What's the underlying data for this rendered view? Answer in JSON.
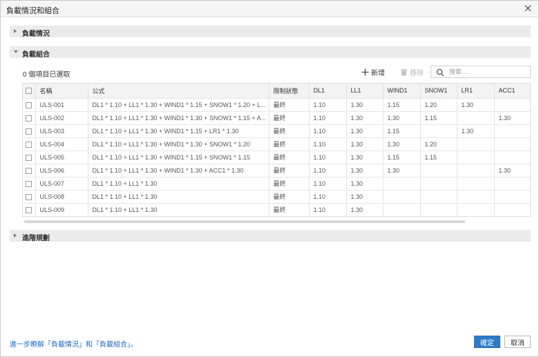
{
  "dialog": {
    "title": "負載情況和組合"
  },
  "sections": {
    "load_cases": "負載情況",
    "load_combinations": "負載組合",
    "advanced": "進階規劃"
  },
  "toolbar": {
    "selected_count": "0 個項目已選取",
    "add_label": "新增",
    "remove_label": "移除",
    "search_placeholder": "搜索..."
  },
  "table": {
    "columns": [
      "",
      "名稱",
      "公式",
      "限制狀態",
      "DL1",
      "LL1",
      "WIND1",
      "SNOW1",
      "LR1",
      "ACC1"
    ],
    "rows": [
      [
        "",
        "ULS-001",
        "DL1 * 1.10 + LL1 * 1.30 + WIND1 * 1.15 + SNOW1 * 1.20 + L...",
        "最終",
        "1.10",
        "1.30",
        "1.15",
        "1.20",
        "1.30",
        ""
      ],
      [
        "",
        "ULS-002",
        "DL1 * 1.10 + LL1 * 1.30 + WIND1 * 1.30 + SNOW1 * 1.15 + A...",
        "最終",
        "1.10",
        "1.30",
        "1.30",
        "1.15",
        "",
        "1.30"
      ],
      [
        "",
        "ULS-003",
        "DL1 * 1.10 + LL1 * 1.30 + WIND1 * 1.15 + LR1 * 1.30",
        "最終",
        "1.10",
        "1.30",
        "1.15",
        "",
        "1.30",
        ""
      ],
      [
        "",
        "ULS-004",
        "DL1 * 1.10 + LL1 * 1.30 + WIND1 * 1.30 + SNOW1 * 1.20",
        "最終",
        "1.10",
        "1.30",
        "1.30",
        "1.20",
        "",
        ""
      ],
      [
        "",
        "ULS-005",
        "DL1 * 1.10 + LL1 * 1.30 + WIND1 * 1.15 + SNOW1 * 1.15",
        "最終",
        "1.10",
        "1.30",
        "1.15",
        "1.15",
        "",
        ""
      ],
      [
        "",
        "ULS-006",
        "DL1 * 1.10 + LL1 * 1.30 + WIND1 * 1.30 + ACC1 * 1.30",
        "最終",
        "1.10",
        "1.30",
        "1.30",
        "",
        "",
        "1.30"
      ],
      [
        "",
        "ULS-007",
        "DL1 * 1.10 + LL1 * 1.30",
        "最終",
        "1.10",
        "1.30",
        "",
        "",
        "",
        ""
      ],
      [
        "",
        "ULS-008",
        "DL1 * 1.10 + LL1 * 1.30",
        "最終",
        "1.10",
        "1.30",
        "",
        "",
        "",
        ""
      ],
      [
        "",
        "ULS-009",
        "DL1 * 1.10 + LL1 * 1.30",
        "最終",
        "1.10",
        "1.30",
        "",
        "",
        "",
        ""
      ]
    ]
  },
  "footer": {
    "help_link": "進一步瞭解「負載情況」和「負載組合」。",
    "ok_label": "確定",
    "cancel_label": "取消"
  },
  "icons": {
    "close": "close-icon",
    "collapsed": "caret-right-icon",
    "expanded": "caret-down-icon",
    "add": "plus-icon",
    "remove": "trash-icon",
    "search": "search-icon"
  },
  "colors": {
    "accent": "#2d7dc9",
    "link": "#1a6ec4",
    "section_bg": "#ebebeb",
    "disabled": "#b5b5b5"
  }
}
